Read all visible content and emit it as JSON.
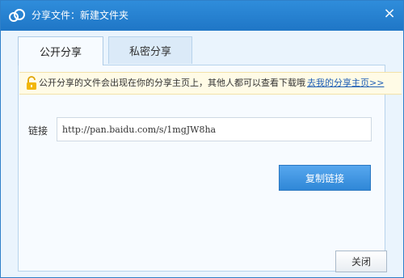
{
  "window": {
    "title": "分享文件：新建文件夹",
    "close_glyph": "×"
  },
  "tabs": [
    {
      "label": "公开分享",
      "active": true
    },
    {
      "label": "私密分享",
      "active": false
    }
  ],
  "notice": {
    "text": "公开分享的文件会出现在你的分享主页上，其他人都可以查看下载哦",
    "link": "去我的分享主页>>"
  },
  "link": {
    "label": "链接",
    "url": "http://pan.baidu.com/s/1mgJW8ha"
  },
  "buttons": {
    "copy": "复制链接",
    "close": "关闭"
  },
  "colors": {
    "titlebar": "#1f76c6",
    "accent": "#2f87d7",
    "notice_bg": "#fffbe6",
    "link": "#1f5fb5"
  },
  "icons": {
    "logo": "baidu-cloud-icon",
    "lock": "unlock-icon",
    "close": "close-icon"
  }
}
